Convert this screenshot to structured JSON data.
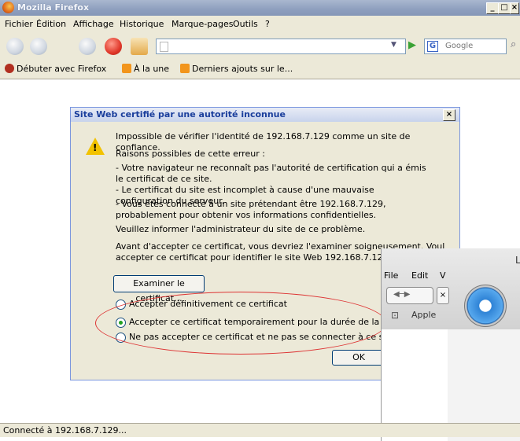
{
  "window": {
    "title": "Mozilla Firefox"
  },
  "menu": [
    "Fichier",
    "Édition",
    "Affichage",
    "Historique",
    "Marque-pages",
    "Outils",
    "?"
  ],
  "search": {
    "engine": "Google"
  },
  "bookmarks": [
    "Débuter avec Firefox",
    "À la une",
    "Derniers ajouts sur le..."
  ],
  "dialog": {
    "title": "Site Web certifié par une autorité inconnue",
    "line1": "Impossible de vérifier l'identité de 192.168.7.129 comme un site de confiance.",
    "line2": "Raisons possibles de cette erreur :",
    "line3": "- Votre navigateur ne reconnaît pas l'autorité de certification qui a émis le certificat de ce site.",
    "line4": "- Le certificat du site est incomplet à cause d'une mauvaise configuration du serveur.",
    "line5": "- Vous êtes connecté à un site prétendant être 192.168.7.129, probablement pour obtenir vos informations confidentielles.",
    "line6": "Veuillez informer l'administrateur du site de ce problème.",
    "line7": "Avant d'accepter ce certificat, vous devriez l'examiner soigneusement. Voul",
    "line8": "accepter ce certificat pour identifier le site Web 192.168.7.129 ?",
    "examine_button": "Examiner le certificat...",
    "options": [
      "Accepter définitivement ce certificat",
      "Accepter ce certificat temporairement pour la durée de la session",
      "Ne pas accepter ce certificat et ne pas se connecter à ce site Web"
    ],
    "ok_button": "OK"
  },
  "safari": {
    "menu": [
      "File",
      "Edit",
      "V"
    ],
    "bookmark": "Apple",
    "title_fragment": "L"
  },
  "status": "Connecté à 192.168.7.129..."
}
